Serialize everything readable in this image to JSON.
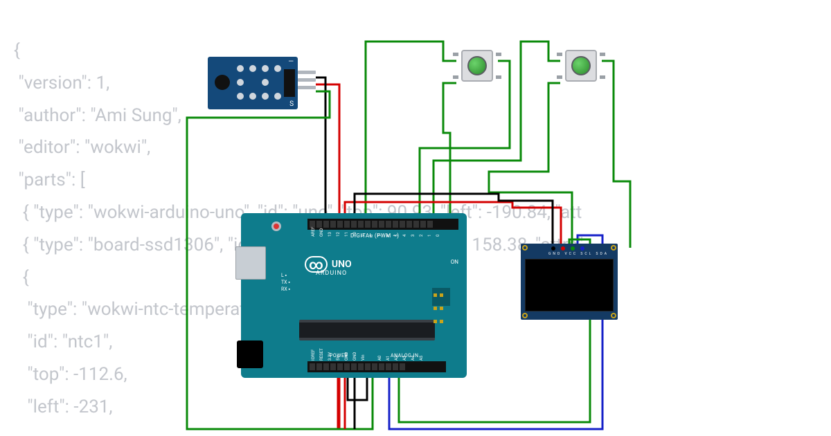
{
  "code": {
    "line1": "{",
    "line2": " \"version\": 1,",
    "line3": " \"author\": \"Ami Sung\",",
    "line4": " \"editor\": \"wokwi\",",
    "line5": " \"parts\": [",
    "line6": "  { \"type\": \"wokwi-arduino-uno\", \"id\": \"uno\", \"top\": 90.93, \"left\": -190.84, \"att",
    "line7": "  { \"type\": \"board-ssd1306\", \"id\": \"oled1\", \"top\": 99.19, \"left\": 158.38, \"attrs\"",
    "line8": "  {",
    "line9": "   \"type\": \"wokwi-ntc-temperature-sensor\",",
    "line10": "   \"id\": \"ntc1\",",
    "line11": "   \"top\": -112.6,",
    "line12": "   \"left\": -231,"
  },
  "arduino": {
    "brand": "UNO",
    "sub": "ARDUINO",
    "digital": "DIGITAL (PWM ~)",
    "power": "POWER",
    "analog": "ANALOG IN",
    "on": "ON",
    "tx": "TX",
    "rx": "RX",
    "l": "L",
    "gnd": "GND"
  },
  "oled": {
    "pins": "GND VCC SCL SDA"
  },
  "ntc": {
    "s": "S",
    "dash": "—"
  },
  "wire_colors": {
    "vcc": "#d40000",
    "gnd": "#000000",
    "signal": "#0a8a0a",
    "sda": "#1520c8",
    "scl": "#0a8a0a"
  }
}
